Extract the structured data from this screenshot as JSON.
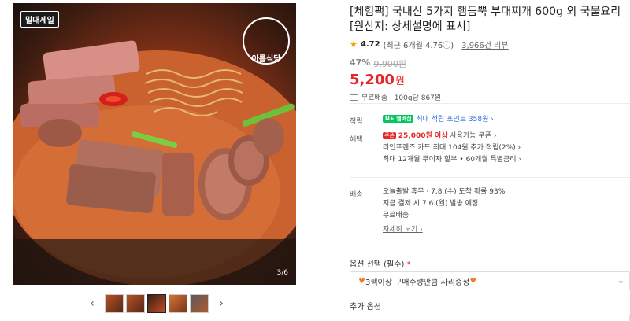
{
  "gallery": {
    "brand_tag": "밀대세일",
    "logo_label": "아름식당",
    "page_indicator": "3/6",
    "thumbs": 5,
    "prev_icon": "chevron-left-icon",
    "next_icon": "chevron-right-icon"
  },
  "product": {
    "title": "[체험팩] 국내산 5가지 햄듬뿍 부대찌개 600g 외 국물요리 [원산지: 상세설명에 표시]",
    "rating": "4.72",
    "rating_detail": "(최근 6개월 4.76ⓘ)",
    "review_count": "3,966건 리뷰",
    "discount_pct": "47%",
    "original_price": "9,900원",
    "price": "5,200",
    "currency": "원",
    "shipping": "무료배송 · 100g당 867원"
  },
  "benefits": {
    "earn_label": "적립",
    "earn_badge": "N+ 멤버십",
    "earn_text": "최대 적립 포인트 358원 ›",
    "perk_label": "혜택",
    "perk_card_badge": "쿠폰",
    "perk_line1_strong": "25,000원 이상",
    "perk_line1_rest": " 사용가능 쿠폰 ›",
    "perk_line2": "라인프렌즈 카드 최대 104원 추가 적립(2%) ›",
    "perk_line3": "최대 12개월 무이자 할부 • 60개월 특별금리 ›"
  },
  "delivery": {
    "label": "배송",
    "line1": "오늘출발 휴무 · 7.8.(수) 도착 확률 93%",
    "line2": "지금 결제 시 7.6.(월) 발송 예정",
    "line3": "무료배송",
    "more": "자세히 보기 ›"
  },
  "options": {
    "select_label": "옵션 선택 (필수)",
    "required_mark": "*",
    "selected_value": "3팩이상 구매수량만큼 사리증정",
    "add_label": "추가 옵션"
  },
  "colors": {
    "price_red": "#e52528",
    "star": "#f2a100",
    "npay_green": "#03c75a"
  }
}
